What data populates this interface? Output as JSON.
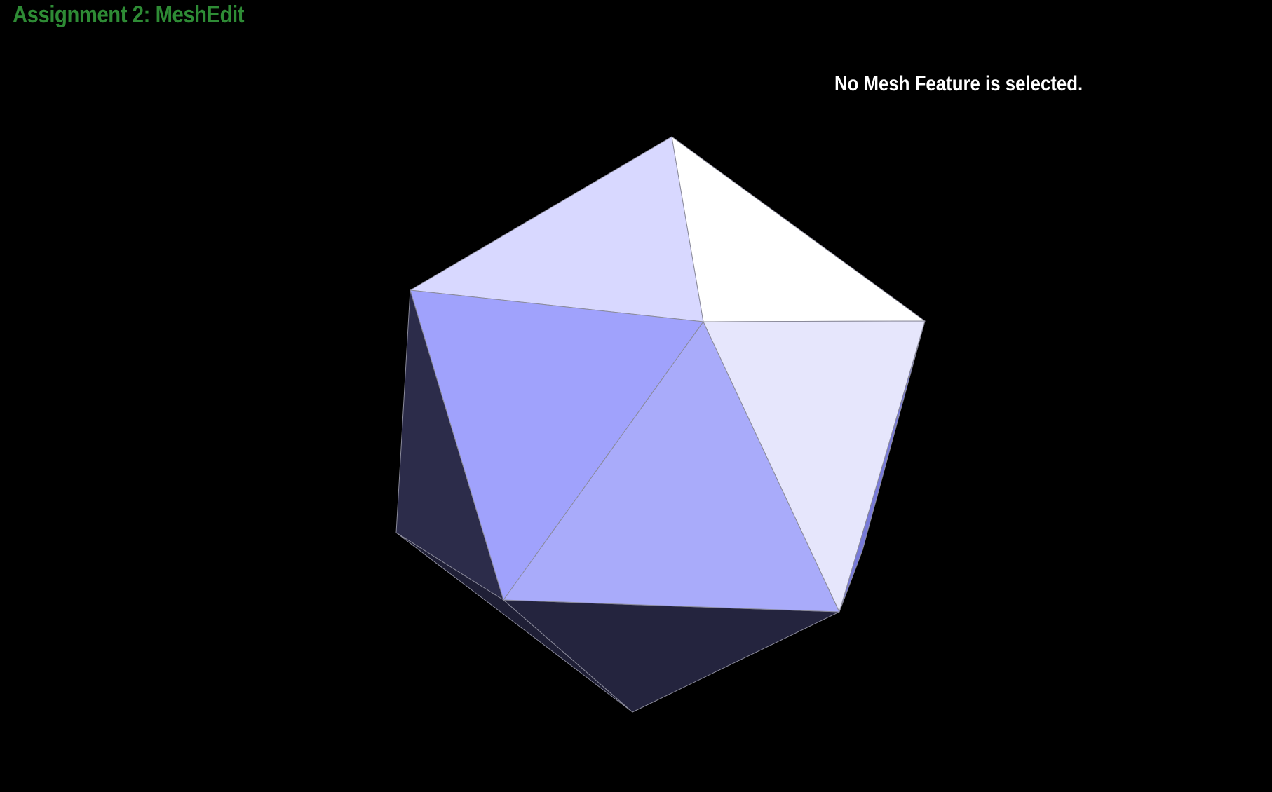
{
  "app": {
    "title": "Assignment 2: MeshEdit"
  },
  "status": {
    "message": "No Mesh Feature is selected."
  },
  "viewport": {
    "background": "#000000",
    "mesh": "icosahedron",
    "face_colors": {
      "top_left": "#d8d8ff",
      "top_right": "#ffffff",
      "left_mid": "#a0a2fc",
      "center": "#a9abfa",
      "right_mid": "#e6e6fc",
      "left_back": "#2c2c4a",
      "bottom_back": "#24243e",
      "right_sliver": "#7779d8",
      "edge": "#8a8a9a"
    }
  },
  "colors": {
    "title": "#2e8b35",
    "status_text": "#ffffff"
  }
}
